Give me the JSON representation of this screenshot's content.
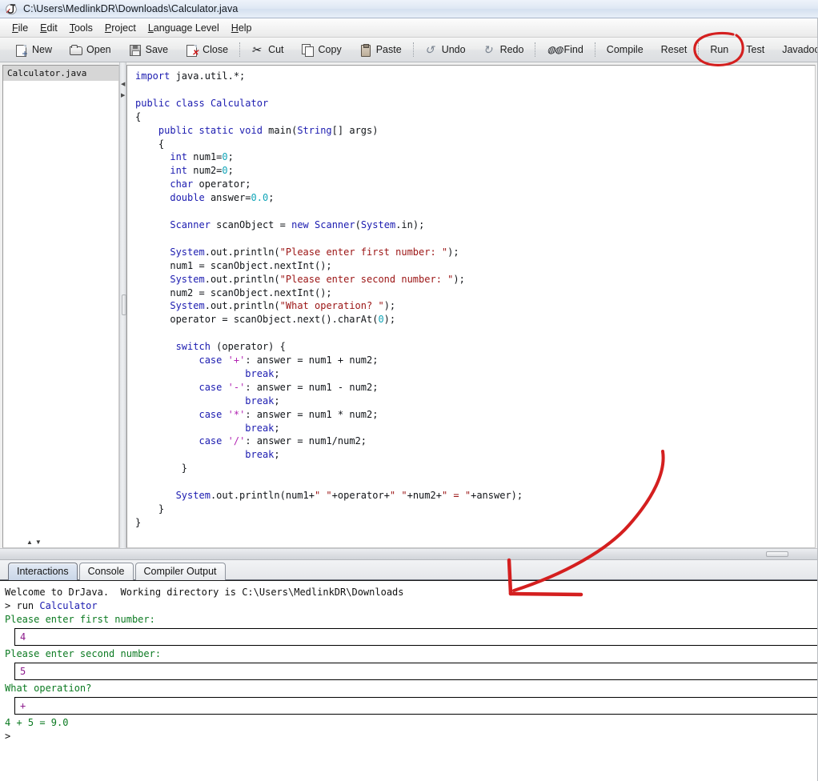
{
  "window": {
    "title": "C:\\Users\\MedlinkDR\\Downloads\\Calculator.java",
    "logo_icon": "drjava-j-logo-icon"
  },
  "menubar": {
    "items": [
      {
        "mnemonic": "F",
        "rest": "ile"
      },
      {
        "mnemonic": "E",
        "rest": "dit"
      },
      {
        "mnemonic": "T",
        "rest": "ools"
      },
      {
        "mnemonic": "P",
        "rest": "roject"
      },
      {
        "mnemonic": "L",
        "rest": "anguage Level"
      },
      {
        "mnemonic": "H",
        "rest": "elp"
      }
    ]
  },
  "toolbar": {
    "new_label": "New",
    "open_label": "Open",
    "save_label": "Save",
    "close_label": "Close",
    "cut_label": "Cut",
    "copy_label": "Copy",
    "paste_label": "Paste",
    "undo_label": "Undo",
    "redo_label": "Redo",
    "find_label": "Find",
    "compile_label": "Compile",
    "reset_label": "Reset",
    "run_label": "Run",
    "test_label": "Test",
    "javadoc_label": "Javadoc"
  },
  "annotations": {
    "color": "#d41f1f",
    "run_circle": "hand-drawn red circle around Run button",
    "arrow": "hand-drawn red arrow pointing to Interactions pane"
  },
  "file_list": {
    "items": [
      "Calculator.java"
    ]
  },
  "editor": {
    "filename": "Calculator.java",
    "lines": [
      [
        {
          "t": "import",
          "c": "k"
        },
        {
          "t": " java.util.*;",
          "c": ""
        }
      ],
      [],
      [
        {
          "t": "public class",
          "c": "k"
        },
        {
          "t": " ",
          "c": ""
        },
        {
          "t": "Calculator",
          "c": "k"
        }
      ],
      [
        {
          "t": "{",
          "c": ""
        }
      ],
      [
        {
          "t": "    ",
          "c": ""
        },
        {
          "t": "public static void",
          "c": "k"
        },
        {
          "t": " main(",
          "c": ""
        },
        {
          "t": "String",
          "c": "k"
        },
        {
          "t": "[] args)",
          "c": ""
        }
      ],
      [
        {
          "t": "    {",
          "c": ""
        }
      ],
      [
        {
          "t": "      ",
          "c": ""
        },
        {
          "t": "int",
          "c": "k"
        },
        {
          "t": " num1=",
          "c": ""
        },
        {
          "t": "0",
          "c": "num"
        },
        {
          "t": ";",
          "c": ""
        }
      ],
      [
        {
          "t": "      ",
          "c": ""
        },
        {
          "t": "int",
          "c": "k"
        },
        {
          "t": " num2=",
          "c": ""
        },
        {
          "t": "0",
          "c": "num"
        },
        {
          "t": ";",
          "c": ""
        }
      ],
      [
        {
          "t": "      ",
          "c": ""
        },
        {
          "t": "char",
          "c": "k"
        },
        {
          "t": " operator;",
          "c": ""
        }
      ],
      [
        {
          "t": "      ",
          "c": ""
        },
        {
          "t": "double",
          "c": "k"
        },
        {
          "t": " answer=",
          "c": ""
        },
        {
          "t": "0.0",
          "c": "num"
        },
        {
          "t": ";",
          "c": ""
        }
      ],
      [],
      [
        {
          "t": "      ",
          "c": ""
        },
        {
          "t": "Scanner",
          "c": "k"
        },
        {
          "t": " scanObject = ",
          "c": ""
        },
        {
          "t": "new",
          "c": "k"
        },
        {
          "t": " ",
          "c": ""
        },
        {
          "t": "Scanner",
          "c": "k"
        },
        {
          "t": "(",
          "c": ""
        },
        {
          "t": "System",
          "c": "k"
        },
        {
          "t": ".in);",
          "c": ""
        }
      ],
      [],
      [
        {
          "t": "      ",
          "c": ""
        },
        {
          "t": "System",
          "c": "k"
        },
        {
          "t": ".out.println(",
          "c": ""
        },
        {
          "t": "\"Please enter first number: \"",
          "c": "str"
        },
        {
          "t": ");",
          "c": ""
        }
      ],
      [
        {
          "t": "      num1 = scanObject.nextInt();",
          "c": ""
        }
      ],
      [
        {
          "t": "      ",
          "c": ""
        },
        {
          "t": "System",
          "c": "k"
        },
        {
          "t": ".out.println(",
          "c": ""
        },
        {
          "t": "\"Please enter second number: \"",
          "c": "str"
        },
        {
          "t": ");",
          "c": ""
        }
      ],
      [
        {
          "t": "      num2 = scanObject.nextInt();",
          "c": ""
        }
      ],
      [
        {
          "t": "      ",
          "c": ""
        },
        {
          "t": "System",
          "c": "k"
        },
        {
          "t": ".out.println(",
          "c": ""
        },
        {
          "t": "\"What operation? \"",
          "c": "str"
        },
        {
          "t": ");",
          "c": ""
        }
      ],
      [
        {
          "t": "      operator = scanObject.next().charAt(",
          "c": ""
        },
        {
          "t": "0",
          "c": "num"
        },
        {
          "t": ");",
          "c": ""
        }
      ],
      [],
      [
        {
          "t": "       ",
          "c": ""
        },
        {
          "t": "switch",
          "c": "k"
        },
        {
          "t": " (operator) {",
          "c": ""
        }
      ],
      [
        {
          "t": "           ",
          "c": ""
        },
        {
          "t": "case",
          "c": "k"
        },
        {
          "t": " ",
          "c": ""
        },
        {
          "t": "'+'",
          "c": "chr"
        },
        {
          "t": ": answer = num1 + num2;",
          "c": ""
        }
      ],
      [
        {
          "t": "                   ",
          "c": ""
        },
        {
          "t": "break",
          "c": "k"
        },
        {
          "t": ";",
          "c": ""
        }
      ],
      [
        {
          "t": "           ",
          "c": ""
        },
        {
          "t": "case",
          "c": "k"
        },
        {
          "t": " ",
          "c": ""
        },
        {
          "t": "'-'",
          "c": "chr"
        },
        {
          "t": ": answer = num1 - num2;",
          "c": ""
        }
      ],
      [
        {
          "t": "                   ",
          "c": ""
        },
        {
          "t": "break",
          "c": "k"
        },
        {
          "t": ";",
          "c": ""
        }
      ],
      [
        {
          "t": "           ",
          "c": ""
        },
        {
          "t": "case",
          "c": "k"
        },
        {
          "t": " ",
          "c": ""
        },
        {
          "t": "'*'",
          "c": "chr"
        },
        {
          "t": ": answer = num1 * num2;",
          "c": ""
        }
      ],
      [
        {
          "t": "                   ",
          "c": ""
        },
        {
          "t": "break",
          "c": "k"
        },
        {
          "t": ";",
          "c": ""
        }
      ],
      [
        {
          "t": "           ",
          "c": ""
        },
        {
          "t": "case",
          "c": "k"
        },
        {
          "t": " ",
          "c": ""
        },
        {
          "t": "'/'",
          "c": "chr"
        },
        {
          "t": ": answer = num1/num2;",
          "c": ""
        }
      ],
      [
        {
          "t": "                   ",
          "c": ""
        },
        {
          "t": "break",
          "c": "k"
        },
        {
          "t": ";",
          "c": ""
        }
      ],
      [
        {
          "t": "        }",
          "c": ""
        }
      ],
      [],
      [
        {
          "t": "       ",
          "c": ""
        },
        {
          "t": "System",
          "c": "k"
        },
        {
          "t": ".out.println(num1+",
          "c": ""
        },
        {
          "t": "\" \"",
          "c": "str"
        },
        {
          "t": "+operator+",
          "c": ""
        },
        {
          "t": "\" \"",
          "c": "str"
        },
        {
          "t": "+num2+",
          "c": ""
        },
        {
          "t": "\" = \"",
          "c": "str"
        },
        {
          "t": "+answer);",
          "c": ""
        }
      ],
      [
        {
          "t": "    }",
          "c": ""
        }
      ],
      [
        {
          "t": "}",
          "c": ""
        }
      ]
    ]
  },
  "bottom": {
    "tabs": [
      {
        "label": "Interactions",
        "active": true
      },
      {
        "label": "Console",
        "active": false
      },
      {
        "label": "Compiler Output",
        "active": false
      }
    ],
    "interactions": {
      "welcome": "Welcome to DrJava.  Working directory is C:\\Users\\MedlinkDR\\Downloads",
      "prompt_symbol": ">",
      "run_command": "run Calculator",
      "prompt_first": "Please enter first number:",
      "input_first": "4",
      "prompt_second": "Please enter second number:",
      "input_second": "5",
      "prompt_operation": "What operation?",
      "input_operation": "+",
      "result": "4 + 5 = 9.0",
      "final_prompt": ">"
    }
  }
}
